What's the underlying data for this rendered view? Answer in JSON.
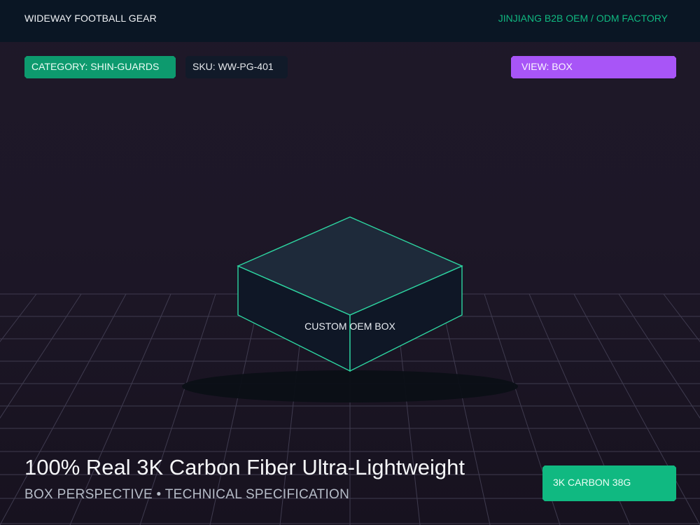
{
  "header": {
    "brand": "WIDEWAY FOOTBALL GEAR",
    "factory": "JINJIANG B2B OEM / ODM FACTORY"
  },
  "chips": {
    "category": "CATEGORY: SHIN-GUARDS",
    "sku": "SKU: WW-PG-401",
    "view": "VIEW: BOX"
  },
  "product": {
    "box_label": "CUSTOM OEM BOX",
    "headline": "100% Real 3K Carbon Fiber Ultra-Lightweight",
    "subline": "BOX PERSPECTIVE • TECHNICAL SPECIFICATION",
    "spec_badge": "3K CARBON 38G"
  },
  "colors": {
    "accent_green": "#10b981",
    "accent_purple": "#a855f7",
    "box_edge": "#2dd4a0",
    "grid_line": "#3f3b4f"
  }
}
